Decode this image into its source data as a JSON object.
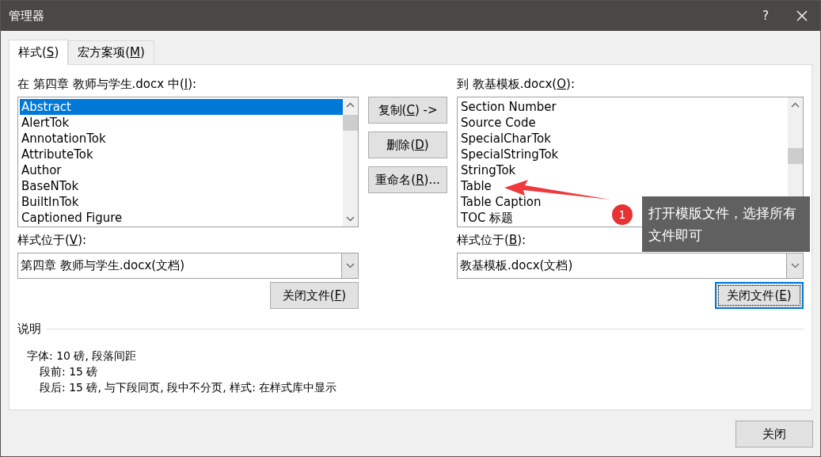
{
  "window": {
    "title": "管理器",
    "help": "?"
  },
  "tabs": [
    {
      "label": "样式(S)",
      "selected": true
    },
    {
      "label": "宏方案项(M)",
      "selected": false
    }
  ],
  "left": {
    "label": "在 第四章 教师与学生.docx 中(I):",
    "items": [
      {
        "text": "Abstract",
        "selected": true
      },
      {
        "text": "AlertTok",
        "selected": false
      },
      {
        "text": "AnnotationTok",
        "selected": false
      },
      {
        "text": "AttributeTok",
        "selected": false
      },
      {
        "text": "Author",
        "selected": false
      },
      {
        "text": "BaseNTok",
        "selected": false
      },
      {
        "text": "BuiltInTok",
        "selected": false
      },
      {
        "text": "Captioned Figure",
        "selected": false
      }
    ],
    "source_label": "样式位于(V):",
    "source_value": "第四章 教师与学生.docx(文档)",
    "close_file": {
      "label": "关闭文件(F)",
      "focused": false
    }
  },
  "actions": [
    "复制(C) ->",
    "删除(D)",
    "重命名(R)..."
  ],
  "right": {
    "label": "到 教基模板.docx(O):",
    "items": [
      {
        "text": "Section Number",
        "selected": false
      },
      {
        "text": "Source Code",
        "selected": false
      },
      {
        "text": "SpecialCharTok",
        "selected": false
      },
      {
        "text": "SpecialStringTok",
        "selected": false
      },
      {
        "text": "StringTok",
        "selected": false
      },
      {
        "text": "Table",
        "selected": false
      },
      {
        "text": "Table Caption",
        "selected": false
      },
      {
        "text": "TOC 标题",
        "selected": false
      }
    ],
    "source_label": "样式位于(B):",
    "source_value": "教基模板.docx(文档)",
    "close_file": {
      "label": "关闭文件(E)",
      "focused": true
    }
  },
  "description": {
    "title": "说明",
    "lines": [
      "字体: 10 磅, 段落间距",
      "段前: 15 磅",
      "段后: 15 磅, 与下段同页, 段中不分页, 样式: 在样式库中显示"
    ]
  },
  "close_button": "关闭",
  "annotation": {
    "number": "1",
    "text": "打开模版文件，选择所有文件即可"
  }
}
